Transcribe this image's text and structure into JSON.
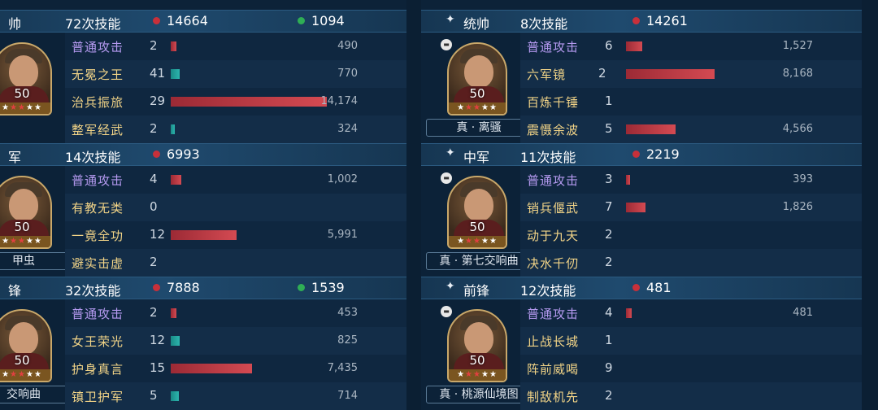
{
  "left": {
    "sections": [
      {
        "role": "帅",
        "count": "72次技能",
        "damage": "14664",
        "heal": "1094",
        "hero_name": "",
        "level": "50",
        "skills": [
          {
            "name": "普通攻击",
            "count": "2",
            "value": "490",
            "kind": "normal",
            "bar": 0.035,
            "bar_color": "red"
          },
          {
            "name": "无冕之王",
            "count": "41",
            "value": "770",
            "kind": "gold",
            "bar": 0.055,
            "bar_color": "teal"
          },
          {
            "name": "治兵振旅",
            "count": "29",
            "value": "14,174",
            "kind": "gold",
            "bar": 1.0,
            "bar_color": "red"
          },
          {
            "name": "整军经武",
            "count": "2",
            "value": "324",
            "kind": "gold",
            "bar": 0.025,
            "bar_color": "teal"
          }
        ]
      },
      {
        "role": "军",
        "count": "14次技能",
        "damage": "6993",
        "heal": "",
        "hero_name": "甲虫",
        "level": "50",
        "skills": [
          {
            "name": "普通攻击",
            "count": "4",
            "value": "1,002",
            "kind": "normal",
            "bar": 0.07,
            "bar_color": "red"
          },
          {
            "name": "有教无类",
            "count": "0",
            "value": "",
            "kind": "gold",
            "bar": 0,
            "bar_color": "red"
          },
          {
            "name": "一竟全功",
            "count": "12",
            "value": "5,991",
            "kind": "gold",
            "bar": 0.42,
            "bar_color": "red"
          },
          {
            "name": "避实击虚",
            "count": "2",
            "value": "",
            "kind": "gold",
            "bar": 0,
            "bar_color": "red"
          }
        ]
      },
      {
        "role": "锋",
        "count": "32次技能",
        "damage": "7888",
        "heal": "1539",
        "hero_name": "交响曲",
        "level": "50",
        "skills": [
          {
            "name": "普通攻击",
            "count": "2",
            "value": "453",
            "kind": "normal",
            "bar": 0.035,
            "bar_color": "red"
          },
          {
            "name": "女王荣光",
            "count": "12",
            "value": "825",
            "kind": "gold",
            "bar": 0.058,
            "bar_color": "teal"
          },
          {
            "name": "护身真言",
            "count": "15",
            "value": "7,435",
            "kind": "gold",
            "bar": 0.52,
            "bar_color": "red"
          },
          {
            "name": "镇卫护军",
            "count": "5",
            "value": "714",
            "kind": "gold",
            "bar": 0.05,
            "bar_color": "teal"
          }
        ]
      }
    ]
  },
  "right": {
    "sections": [
      {
        "icon": "✦",
        "role": "统帅",
        "count": "8次技能",
        "damage": "14261",
        "heal": "",
        "hero_name": "真 · 离骚",
        "level": "50",
        "skills": [
          {
            "name": "普通攻击",
            "count": "6",
            "value": "1,527",
            "kind": "normal",
            "bar": 0.105,
            "bar_color": "red"
          },
          {
            "name": "六军镜",
            "count": "2",
            "value": "8,168",
            "kind": "gold",
            "bar": 0.57,
            "bar_color": "red"
          },
          {
            "name": "百炼千锤",
            "count": "1",
            "value": "",
            "kind": "gold",
            "bar": 0,
            "bar_color": "red"
          },
          {
            "name": "震慑余波",
            "count": "5",
            "value": "4,566",
            "kind": "gold",
            "bar": 0.32,
            "bar_color": "red"
          }
        ]
      },
      {
        "icon": "✦",
        "role": "中军",
        "count": "11次技能",
        "damage": "2219",
        "heal": "",
        "hero_name": "真 · 第七交响曲",
        "level": "50",
        "skills": [
          {
            "name": "普通攻击",
            "count": "3",
            "value": "393",
            "kind": "normal",
            "bar": 0.028,
            "bar_color": "red"
          },
          {
            "name": "销兵偃武",
            "count": "7",
            "value": "1,826",
            "kind": "gold",
            "bar": 0.127,
            "bar_color": "red"
          },
          {
            "name": "动于九天",
            "count": "2",
            "value": "",
            "kind": "gold",
            "bar": 0,
            "bar_color": "red"
          },
          {
            "name": "决水千仞",
            "count": "2",
            "value": "",
            "kind": "gold",
            "bar": 0,
            "bar_color": "red"
          }
        ]
      },
      {
        "icon": "✦",
        "role": "前锋",
        "count": "12次技能",
        "damage": "481",
        "heal": "",
        "hero_name": "真 · 桃源仙境图",
        "level": "50",
        "skills": [
          {
            "name": "普通攻击",
            "count": "4",
            "value": "481",
            "kind": "normal",
            "bar": 0.034,
            "bar_color": "red"
          },
          {
            "name": "止战长城",
            "count": "1",
            "value": "",
            "kind": "gold",
            "bar": 0,
            "bar_color": "red"
          },
          {
            "name": "阵前威喝",
            "count": "9",
            "value": "",
            "kind": "gold",
            "bar": 0,
            "bar_color": "red"
          },
          {
            "name": "制敌机先",
            "count": "2",
            "value": "",
            "kind": "gold",
            "bar": 0,
            "bar_color": "red"
          }
        ]
      }
    ]
  }
}
